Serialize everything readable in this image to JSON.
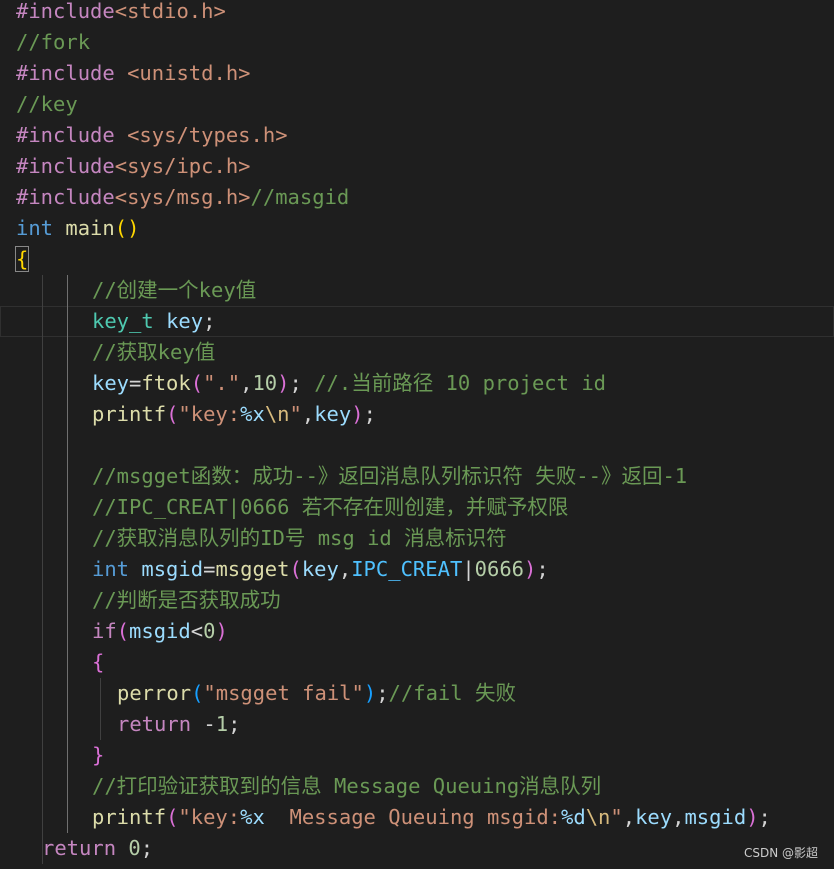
{
  "editor": {
    "language": "c",
    "lines": [
      {
        "indent": 0,
        "tokens": [
          [
            "dir",
            "#include"
          ],
          [
            "inc",
            "<stdio.h>"
          ]
        ]
      },
      {
        "indent": 0,
        "tokens": [
          [
            "com",
            "//fork"
          ]
        ]
      },
      {
        "indent": 0,
        "tokens": [
          [
            "dir",
            "#include "
          ],
          [
            "inc",
            "<unistd.h>"
          ]
        ]
      },
      {
        "indent": 0,
        "tokens": [
          [
            "com",
            "//key"
          ]
        ]
      },
      {
        "indent": 0,
        "tokens": [
          [
            "dir",
            "#include "
          ],
          [
            "inc",
            "<sys/types.h>"
          ]
        ]
      },
      {
        "indent": 0,
        "tokens": [
          [
            "dir",
            "#include"
          ],
          [
            "inc",
            "<sys/ipc.h>"
          ]
        ]
      },
      {
        "indent": 0,
        "tokens": [
          [
            "dir",
            "#include"
          ],
          [
            "inc",
            "<sys/msg.h>"
          ],
          [
            "com",
            "//masgid"
          ]
        ]
      },
      {
        "indent": 0,
        "tokens": [
          [
            "kw",
            "int"
          ],
          [
            "pun",
            " "
          ],
          [
            "fn",
            "main"
          ],
          [
            "p1",
            "()"
          ]
        ]
      },
      {
        "indent": 0,
        "tokens": [
          [
            "p1",
            "{"
          ]
        ],
        "bracketMatch": true
      },
      {
        "indent": 2,
        "tokens": [
          [
            "com",
            "//创建一个key值"
          ]
        ]
      },
      {
        "indent": 2,
        "current": true,
        "tokens": [
          [
            "type",
            "key_t"
          ],
          [
            "pun",
            " "
          ],
          [
            "var",
            "key"
          ],
          [
            "pun",
            ";"
          ]
        ]
      },
      {
        "indent": 2,
        "tokens": [
          [
            "com",
            "//获取key值"
          ]
        ]
      },
      {
        "indent": 2,
        "tokens": [
          [
            "var",
            "key"
          ],
          [
            "pun",
            "="
          ],
          [
            "fn",
            "ftok"
          ],
          [
            "p2",
            "("
          ],
          [
            "str",
            "\".\""
          ],
          [
            "pun",
            ","
          ],
          [
            "num",
            "10"
          ],
          [
            "p2",
            ")"
          ],
          [
            "pun",
            "; "
          ],
          [
            "com",
            "//.当前路径 10 project id"
          ]
        ]
      },
      {
        "indent": 2,
        "tokens": [
          [
            "fn",
            "printf"
          ],
          [
            "p2",
            "("
          ],
          [
            "str",
            "\"key:"
          ],
          [
            "fmt",
            "%x"
          ],
          [
            "esc",
            "\\n"
          ],
          [
            "str",
            "\""
          ],
          [
            "pun",
            ","
          ],
          [
            "var",
            "key"
          ],
          [
            "p2",
            ")"
          ],
          [
            "pun",
            ";"
          ]
        ]
      },
      {
        "indent": 2,
        "tokens": []
      },
      {
        "indent": 2,
        "tokens": [
          [
            "com",
            "//msgget函数：成功--》返回消息队列标识符 失败--》返回-1"
          ]
        ]
      },
      {
        "indent": 2,
        "tokens": [
          [
            "com",
            "//IPC_CREAT|0666 若不存在则创建，并赋予权限"
          ]
        ]
      },
      {
        "indent": 2,
        "tokens": [
          [
            "com",
            "//获取消息队列的ID号 msg id 消息标识符"
          ]
        ]
      },
      {
        "indent": 2,
        "tokens": [
          [
            "kw",
            "int"
          ],
          [
            "pun",
            " "
          ],
          [
            "var",
            "msgid"
          ],
          [
            "pun",
            "="
          ],
          [
            "fn",
            "msgget"
          ],
          [
            "p2",
            "("
          ],
          [
            "var",
            "key"
          ],
          [
            "pun",
            ","
          ],
          [
            "const",
            "IPC_CREAT"
          ],
          [
            "pun",
            "|"
          ],
          [
            "num",
            "0666"
          ],
          [
            "p2",
            ")"
          ],
          [
            "pun",
            ";"
          ]
        ]
      },
      {
        "indent": 2,
        "tokens": [
          [
            "com",
            "//判断是否获取成功"
          ]
        ]
      },
      {
        "indent": 2,
        "tokens": [
          [
            "ctl",
            "if"
          ],
          [
            "p2",
            "("
          ],
          [
            "var",
            "msgid"
          ],
          [
            "pun",
            "<"
          ],
          [
            "num",
            "0"
          ],
          [
            "p2",
            ")"
          ]
        ]
      },
      {
        "indent": 2,
        "tokens": [
          [
            "p2",
            "{"
          ]
        ]
      },
      {
        "indent": 3,
        "tokens": [
          [
            "fn",
            "perror"
          ],
          [
            "p3",
            "("
          ],
          [
            "str",
            "\"msgget fail\""
          ],
          [
            "p3",
            ")"
          ],
          [
            "pun",
            ";"
          ],
          [
            "com",
            "//fail 失败"
          ]
        ]
      },
      {
        "indent": 3,
        "tokens": [
          [
            "ctl",
            "return"
          ],
          [
            "pun",
            " -"
          ],
          [
            "num",
            "1"
          ],
          [
            "pun",
            ";"
          ]
        ]
      },
      {
        "indent": 2,
        "tokens": [
          [
            "p2",
            "}"
          ]
        ]
      },
      {
        "indent": 2,
        "tokens": [
          [
            "com",
            "//打印验证获取到的信息 Message Queuing消息队列"
          ]
        ]
      },
      {
        "indent": 2,
        "tokens": [
          [
            "fn",
            "printf"
          ],
          [
            "p2",
            "("
          ],
          [
            "str",
            "\"key:"
          ],
          [
            "fmt",
            "%x"
          ],
          [
            "str",
            "  Message Queuing msgid:"
          ],
          [
            "fmt",
            "%d"
          ],
          [
            "esc",
            "\\n"
          ],
          [
            "str",
            "\""
          ],
          [
            "pun",
            ","
          ],
          [
            "var",
            "key"
          ],
          [
            "pun",
            ","
          ],
          [
            "var",
            "msgid"
          ],
          [
            "p2",
            ")"
          ],
          [
            "pun",
            ";"
          ]
        ]
      },
      {
        "indent": 1,
        "tokens": [
          [
            "ctl",
            "return"
          ],
          [
            "pun",
            " "
          ],
          [
            "num",
            "0"
          ],
          [
            "pun",
            ";"
          ]
        ]
      }
    ]
  },
  "watermark": "CSDN @影超"
}
